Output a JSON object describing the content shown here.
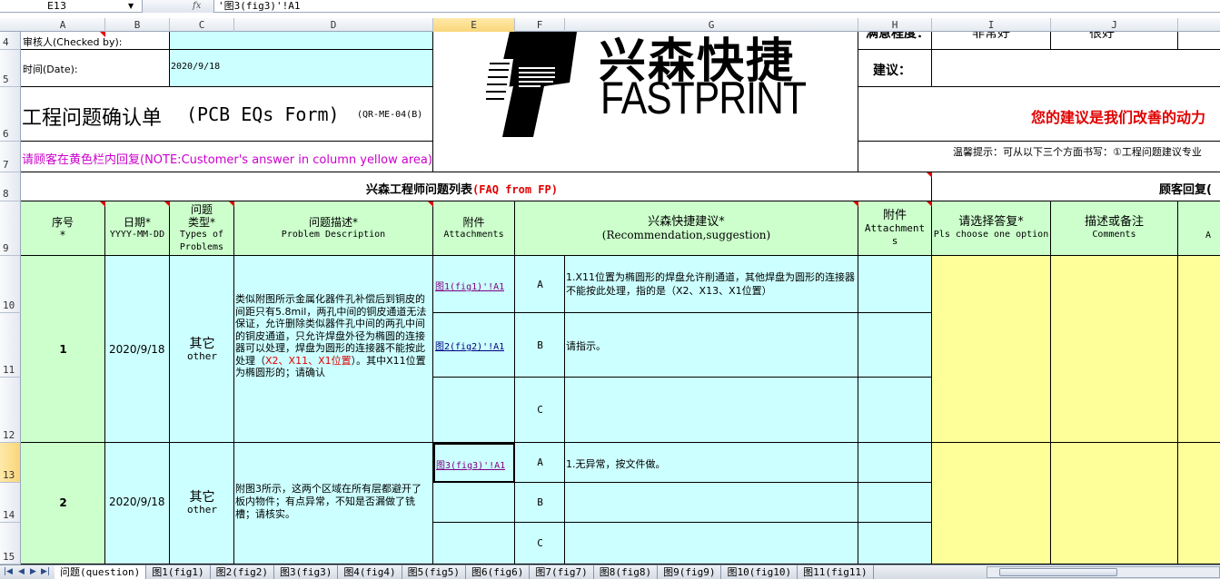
{
  "formula_bar": {
    "name_box": "E13",
    "fx_label": "fx",
    "formula": "'图3(fig3)'!A1"
  },
  "columns": [
    "A",
    "B",
    "C",
    "D",
    "E",
    "F",
    "G",
    "H",
    "I",
    "J"
  ],
  "rows": [
    "4",
    "5",
    "6",
    "7",
    "8",
    "9",
    "10",
    "11",
    "12",
    "13",
    "14",
    "15"
  ],
  "top": {
    "checked_by": "审核人(Checked by):",
    "date_label": "时间(Date):",
    "date_value": "2020/9/18",
    "form_title": "工程问题确认单",
    "form_title_en": "(PCB EQs Form)",
    "form_code": "(QR-ME-04(B)",
    "note": "请顾客在黄色栏内回复(NOTE:Customer's answer in column yellow area)",
    "logo_cn": "兴森快捷",
    "logo_en": "FASTPRINT",
    "h4_partial": "满意程度：",
    "i4_partial": "非常好",
    "j4_partial": "很好",
    "suggest_label": "建议：",
    "slogan": "您的建议是我们改善的动力",
    "tip": "温馨提示：可从以下三个方面书写：①工程问题建议专业"
  },
  "section": {
    "fp_title": "兴森工程师问题列表",
    "fp_title_en": "(FAQ from FP)",
    "customer_title": "顾客回复("
  },
  "headers": {
    "seq": "序号",
    "seq2": "*",
    "date": "日期*",
    "date_en": "YYYY-MM-DD",
    "type": "问题",
    "type2": "类型*",
    "type_en1": "Types of",
    "type_en2": "Problems",
    "desc": "问题描述*",
    "desc_en": "Problem Description",
    "attach": "附件",
    "attach_en": "Attachments",
    "rec": "兴森快捷建议*",
    "rec_en": "(Recommendation,suggestion)",
    "attach2": "附件",
    "attach2_en": "Attachment",
    "attach2_en2": "s",
    "choose": "请选择答复*",
    "choose_en": "Pls choose one option",
    "comment": "描述或备注",
    "comment_en": "Comments",
    "last_partial": "A"
  },
  "issues": [
    {
      "seq": "1",
      "date": "2020/9/18",
      "type_cn": "其它",
      "type_en": "other",
      "desc_a": "类似附图所示金属化器件孔补偿后到铜皮的间距只有5.8mil，两孔中间的铜皮通道无法保证，允许删除类似器件孔中间的两孔中间的铜皮通道，只允许焊盘外径为椭圆的连接器可以处理，焊盘为圆形的连接器不能按此处理（",
      "desc_red": "X2、X11、X1位置",
      "desc_b": "）。其中X11位置为椭圆形的；请确认",
      "options": [
        {
          "letter": "A",
          "attachment": "图1(fig1)'!A1",
          "text": "1.X11位置为椭圆形的焊盘允许削通道，其他焊盘为圆形的连接器不能按此处理，指的是（X2、X13、X1位置）"
        },
        {
          "letter": "B",
          "attachment": "图2(fig2)'!A1",
          "text": "请指示。"
        },
        {
          "letter": "C",
          "attachment": "",
          "text": ""
        }
      ]
    },
    {
      "seq": "2",
      "date": "2020/9/18",
      "type_cn": "其它",
      "type_en": "other",
      "desc_a": "附图3所示，这两个区域在所有层都避开了板内物件；有点异常，不知是否漏做了铣槽；请核实。",
      "desc_red": "",
      "desc_b": "",
      "options": [
        {
          "letter": "A",
          "attachment": "图3(fig3)'!A1",
          "text": "1.无异常，按文件做。"
        },
        {
          "letter": "B",
          "attachment": "",
          "text": ""
        },
        {
          "letter": "C",
          "attachment": "",
          "text": ""
        }
      ]
    }
  ],
  "tabs": [
    "问题(question)",
    "图1(fig1)",
    "图2(fig2)",
    "图3(fig3)",
    "图4(fig4)",
    "图5(fig5)",
    "图6(fig6)",
    "图7(fig7)",
    "图8(fig8)",
    "图9(fig9)",
    "图10(fig10)",
    "图11(fig11)"
  ],
  "active_tab": "问题(question)"
}
